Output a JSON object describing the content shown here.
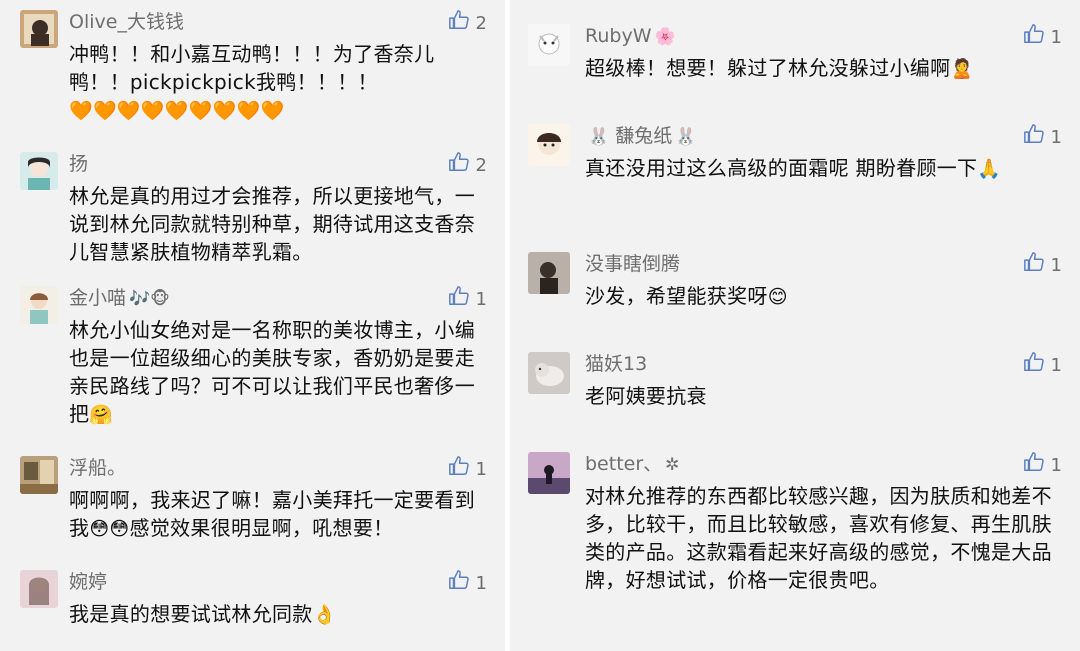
{
  "left": [
    {
      "user": "Olive_大钱钱",
      "user_emoji": "",
      "likes": "2",
      "text": "冲鸭！！和小嘉互动鸭！！！为了香奈儿鸭！！pickpickpick我鸭！！！！",
      "text_emoji": "🧡🧡🧡🧡🧡🧡🧡🧡🧡"
    },
    {
      "user": "扬",
      "user_emoji": "",
      "likes": "2",
      "text": "林允是真的用过才会推荐，所以更接地气，一说到林允同款就特别种草，期待试用这支香奈儿智慧紧肤植物精萃乳霜。",
      "text_emoji": ""
    },
    {
      "user": "金小喵",
      "user_emoji": "🎶🐵",
      "likes": "1",
      "text": "林允小仙女绝对是一名称职的美妆博主，小编也是一位超级细心的美肤专家，香奶奶是要走亲民路线了吗？可不可以让我们平民也奢侈一把",
      "text_emoji": "🤗"
    },
    {
      "user": "浮船。",
      "user_emoji": "",
      "likes": "1",
      "text_a": "啊啊啊，我来迟了嘛！嘉小美拜托一定要看到我",
      "text_emoji": "😳😳",
      "text_b": "感觉效果很明显啊，吼想要！"
    },
    {
      "user": "婉婷",
      "user_emoji": "",
      "likes": "1",
      "text": "我是真的想要试试林允同款",
      "text_emoji": "👌"
    }
  ],
  "right": [
    {
      "user": "RubyW",
      "user_emoji": "🌸",
      "likes": "1",
      "text": "超级棒！想要！躲过了林允没躲过小编啊",
      "text_emoji": "🙎"
    },
    {
      "user": "馦兔纸",
      "user_emoji_pre": "🐰",
      "user_emoji": "🐰",
      "likes": "1",
      "text": "真还没用过这么高级的面霜呢 期盼眷顾一下",
      "text_emoji": "🙏"
    },
    {
      "user": "没事瞎倒腾",
      "user_emoji": "",
      "likes": "1",
      "text": "沙发，希望能获奖呀",
      "text_emoji": "😊"
    },
    {
      "user": "猫妖13",
      "user_emoji": "",
      "likes": "1",
      "text": "老阿姨要抗衰",
      "text_emoji": ""
    },
    {
      "user": "better、",
      "user_emoji": "✲",
      "likes": "1",
      "text": "对林允推荐的东西都比较感兴趣，因为肤质和她差不多，比较干，而且比较敏感，喜欢有修复、再生肌肤类的产品。这款霜看起来好高级的感觉，不愧是大品牌，好想试试，价格一定很贵吧。",
      "text_emoji": ""
    }
  ],
  "colors": {
    "background": "#f2f2f2",
    "name": "#6e6e6e",
    "text": "#111111",
    "like_icon": "#5b7fbf"
  }
}
